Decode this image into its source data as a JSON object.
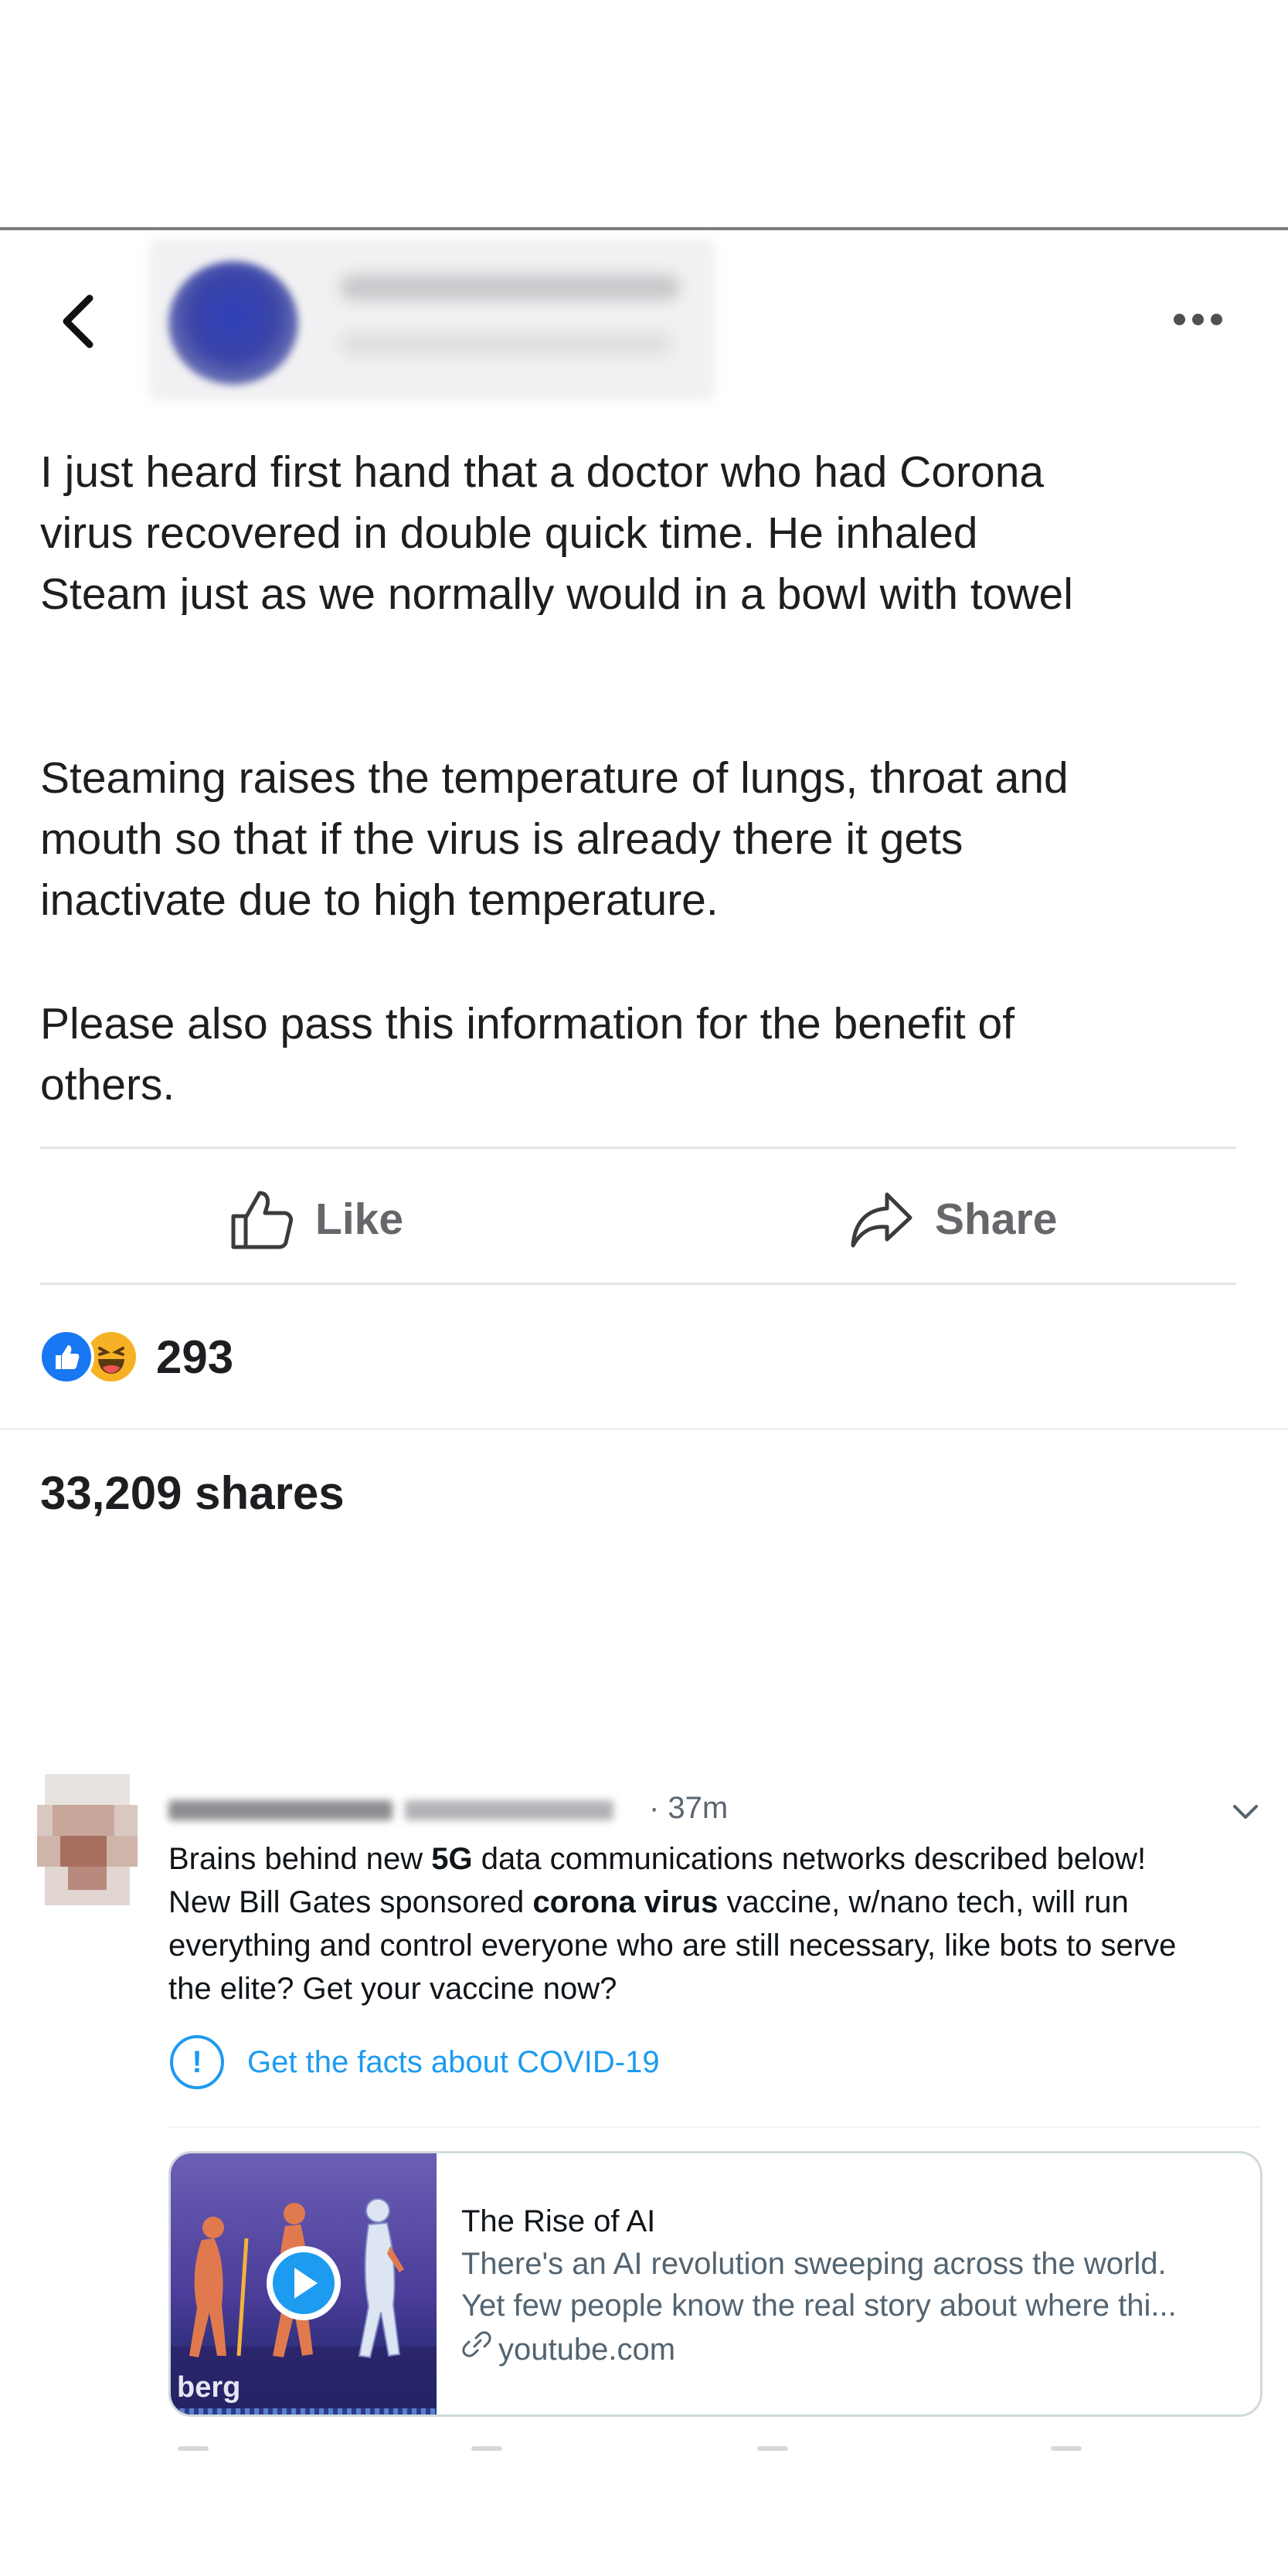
{
  "facebook_post": {
    "paragraphs": [
      [
        "I just heard first hand that a doctor who had Corona",
        "virus recovered in double quick time. He inhaled",
        "Steam just as we normally would in a bowl with towel"
      ],
      [
        "Steaming raises the temperature of lungs, throat and",
        "mouth so that if the virus is already there it gets",
        "inactivate due to high temperature."
      ],
      [
        "Please also pass this information for the benefit of",
        "others."
      ]
    ],
    "actions": {
      "like_label": "Like",
      "share_label": "Share"
    },
    "reaction_count": "293",
    "shares": "33,209 shares",
    "icons": [
      "back-chevron-icon",
      "more-options-icon",
      "thumbs-up-icon",
      "share-arrow-icon",
      "like-reaction-icon",
      "haha-reaction-icon"
    ]
  },
  "tweet": {
    "time": "· 37m",
    "text_lines": [
      [
        {
          "t": "Brains behind new "
        },
        {
          "t": "5G",
          "b": true
        },
        {
          "t": " data communications networks described below!"
        }
      ],
      [
        {
          "t": "New Bill Gates sponsored "
        },
        {
          "t": "corona virus",
          "b": true
        },
        {
          "t": " vaccine, w/nano tech, will run"
        }
      ],
      [
        {
          "t": "everything and control everyone who are still necessary, like bots to serve"
        }
      ],
      [
        {
          "t": "the elite?  Get your vaccine now?"
        }
      ]
    ],
    "facts_label": "Get the facts about COVID-19",
    "card": {
      "title": "The Rise of AI",
      "desc_line1": "There's an AI revolution sweeping across the world.",
      "desc_line2": "Yet few people know the real story about where thi...",
      "domain": "youtube.com",
      "thumb_brand": "berg"
    },
    "colors": {
      "link_blue": "#1d9bf0",
      "secondary_text": "#536471"
    },
    "icons": [
      "caret-down-icon",
      "info-exclamation-icon",
      "play-icon",
      "link-icon"
    ]
  }
}
